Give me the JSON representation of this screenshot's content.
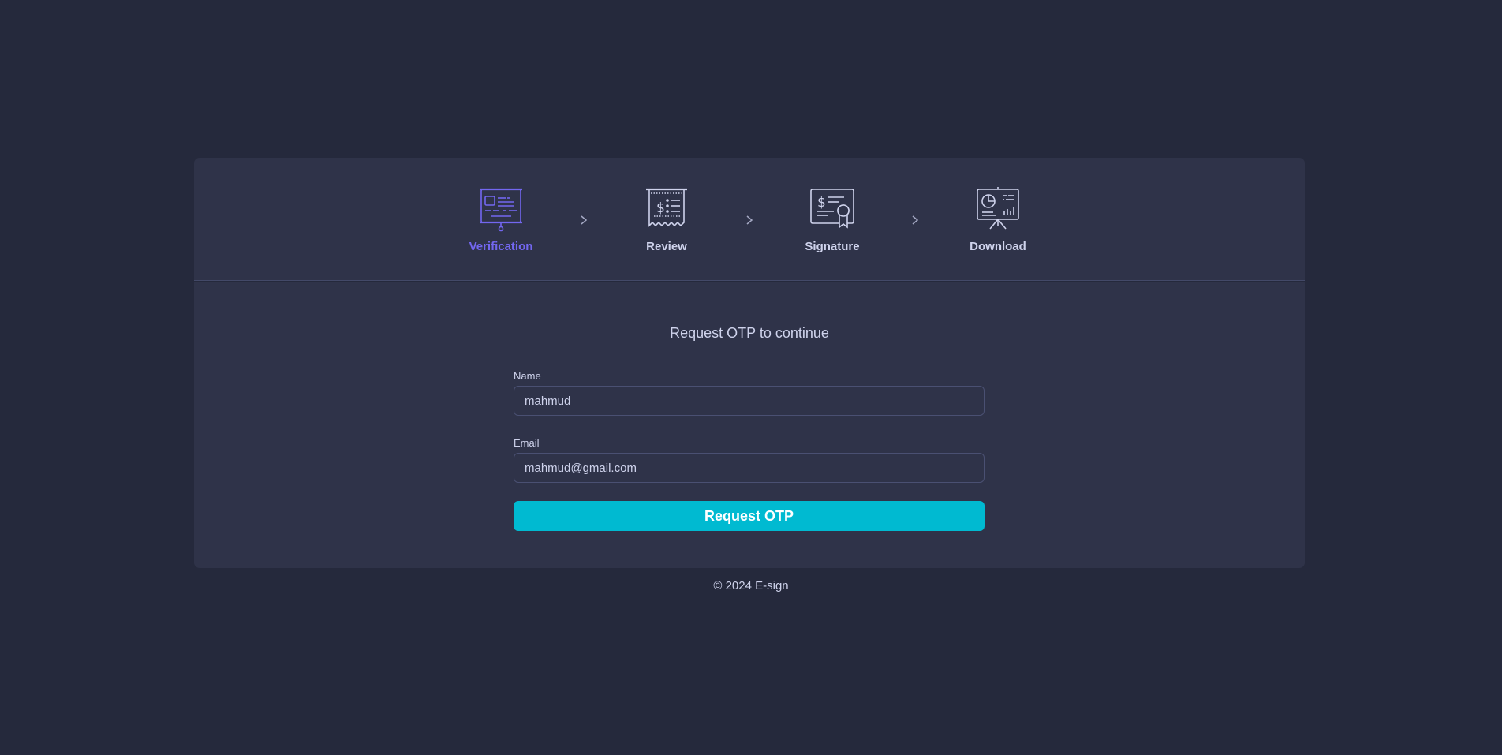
{
  "steps": [
    {
      "label": "Verification",
      "icon": "presentation-id-card-icon",
      "active": true
    },
    {
      "label": "Review",
      "icon": "receipt-icon",
      "active": false
    },
    {
      "label": "Signature",
      "icon": "certificate-icon",
      "active": false
    },
    {
      "label": "Download",
      "icon": "chart-presentation-icon",
      "active": false
    }
  ],
  "form": {
    "title": "Request OTP to continue",
    "name_label": "Name",
    "name_value": "mahmud",
    "email_label": "Email",
    "email_value": "mahmud@gmail.com",
    "submit_label": "Request OTP"
  },
  "footer": {
    "text": "© 2024 E-sign"
  },
  "colors": {
    "background": "#25293c",
    "card": "#2f3349",
    "active_step": "#7367f0",
    "button": "#00bad1"
  }
}
